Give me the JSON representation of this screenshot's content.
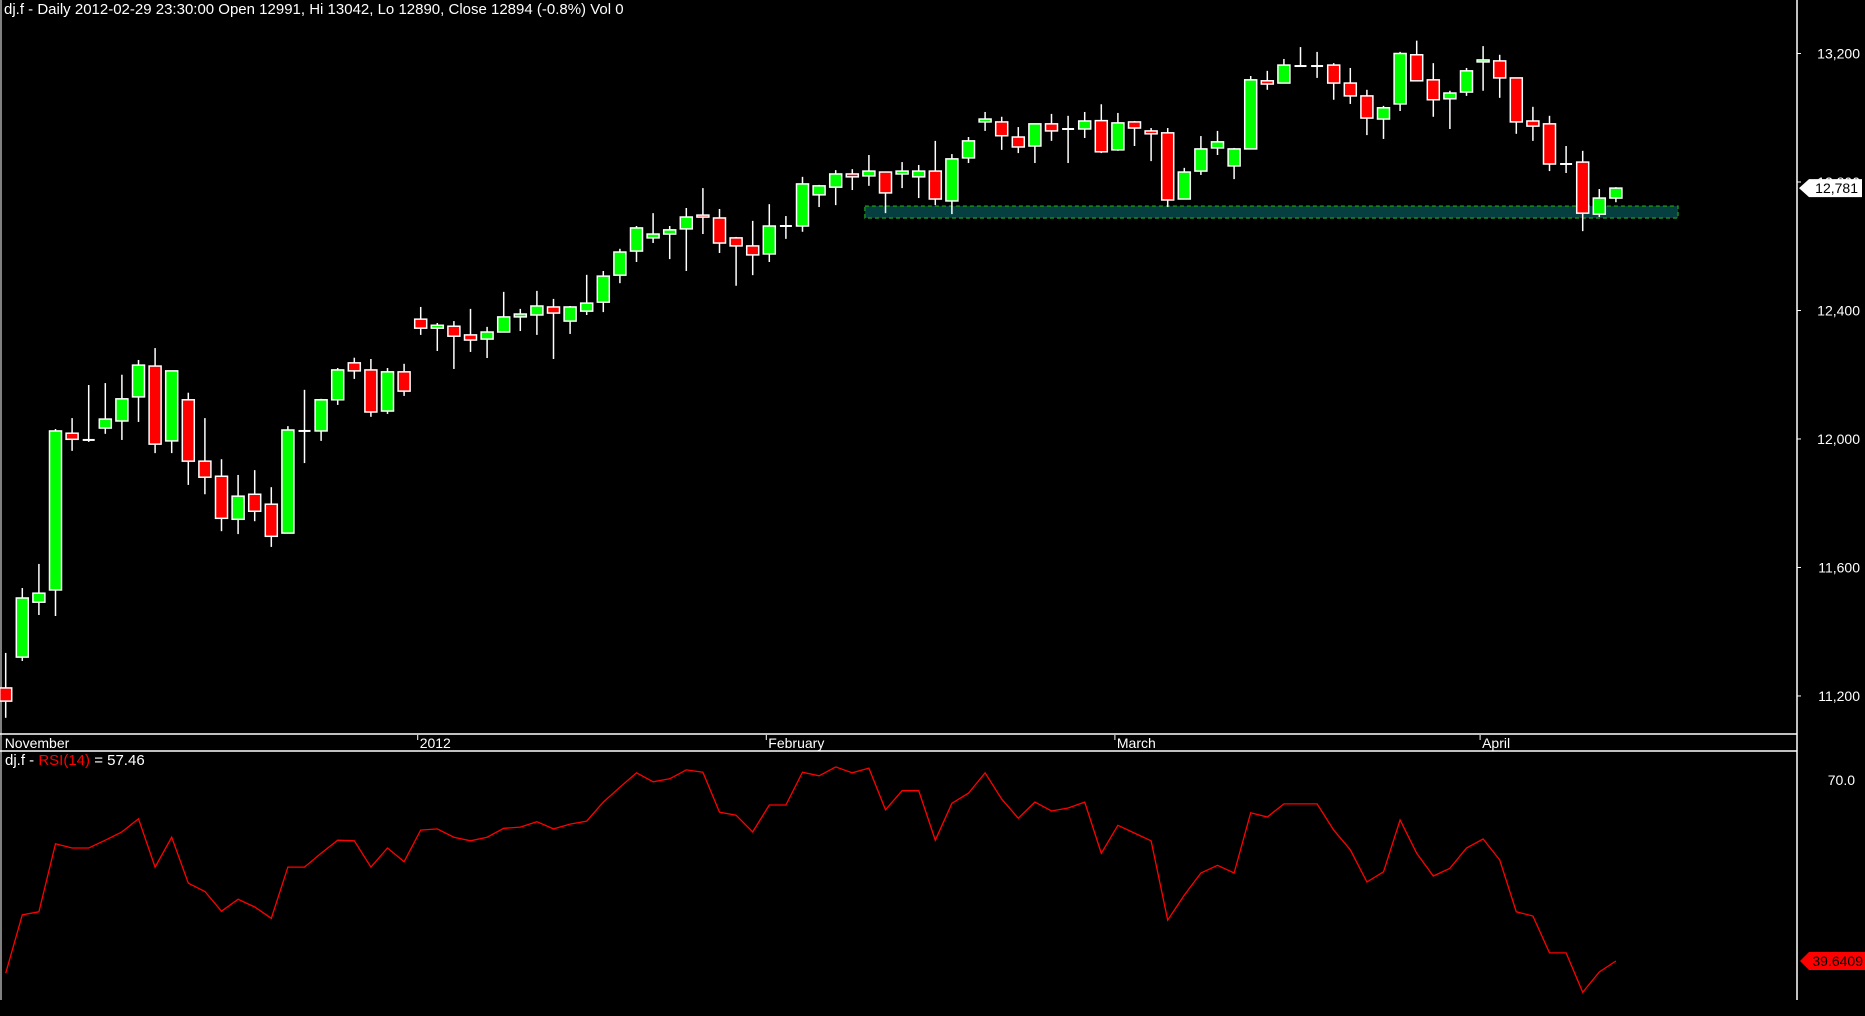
{
  "header": {
    "symbol": "dj.f",
    "text": "dj.f - Daily 2012-02-29 23:30:00 Open 12991, Hi 13042, Lo 12890, Close 12894 (-0.8%) Vol 0"
  },
  "rsi_header": {
    "prefix": "dj.f - ",
    "indicator": "RSI(14)",
    "value_text": " = 57.46"
  },
  "colors": {
    "up": "#00ff00",
    "down": "#ff0000",
    "outline": "#ffffff",
    "rsi": "#ff0000",
    "zone_fill": "#053f3f",
    "zone_border": "#1a8a1a"
  },
  "chart_data": [
    {
      "type": "candlestick",
      "title": "dj.f - Daily",
      "ylim": [
        11200,
        13200
      ],
      "y_ticks": [
        13200,
        12800,
        12400,
        12000,
        11600,
        11200
      ],
      "y_tick_labels": [
        "13,200",
        "12,800",
        "12,400",
        "12,000",
        "11,600",
        "11,200"
      ],
      "x_labels": [
        {
          "label": "November",
          "bar": 0
        },
        {
          "label": "2012",
          "bar": 25
        },
        {
          "label": "February",
          "bar": 46
        },
        {
          "label": "March",
          "bar": 67
        },
        {
          "label": "April",
          "bar": 89
        }
      ],
      "last_price_label": "12,781",
      "last_price": 12781,
      "support_zone": {
        "low": 12688,
        "high": 12725,
        "from_bar": 52
      },
      "ohlc": [
        [
          11225,
          11334,
          11132,
          11184
        ],
        [
          11321,
          11536,
          11309,
          11505
        ],
        [
          11492,
          11611,
          11452,
          11520
        ],
        [
          11530,
          12031,
          11449,
          12025
        ],
        [
          12018,
          12065,
          11963,
          11999
        ],
        [
          11997,
          12168,
          11991,
          11997
        ],
        [
          12034,
          12174,
          12016,
          12062
        ],
        [
          12056,
          12200,
          11997,
          12125
        ],
        [
          12131,
          12246,
          12053,
          12230
        ],
        [
          12227,
          12283,
          11956,
          11984
        ],
        [
          11994,
          12212,
          11956,
          12212
        ],
        [
          12122,
          12144,
          11857,
          11931
        ],
        [
          11931,
          12065,
          11828,
          11881
        ],
        [
          11884,
          11937,
          11713,
          11753
        ],
        [
          11750,
          11888,
          11704,
          11822
        ],
        [
          11828,
          11903,
          11744,
          11775
        ],
        [
          11797,
          11850,
          11664,
          11697
        ],
        [
          11707,
          12040,
          11707,
          12028
        ],
        [
          12025,
          12153,
          11925,
          12025
        ],
        [
          12025,
          12125,
          11994,
          12122
        ],
        [
          12122,
          12221,
          12106,
          12215
        ],
        [
          12237,
          12253,
          12187,
          12212
        ],
        [
          12215,
          12249,
          12069,
          12084
        ],
        [
          12087,
          12221,
          12078,
          12209
        ],
        [
          12209,
          12234,
          12134,
          12149
        ],
        [
          12373,
          12411,
          12324,
          12345
        ],
        [
          12345,
          12361,
          12274,
          12354
        ],
        [
          12351,
          12367,
          12218,
          12320
        ],
        [
          12324,
          12405,
          12271,
          12308
        ],
        [
          12311,
          12349,
          12252,
          12333
        ],
        [
          12333,
          12458,
          12333,
          12380
        ],
        [
          12380,
          12405,
          12336,
          12389
        ],
        [
          12386,
          12461,
          12324,
          12414
        ],
        [
          12411,
          12436,
          12249,
          12392
        ],
        [
          12367,
          12414,
          12327,
          12411
        ],
        [
          12398,
          12511,
          12386,
          12423
        ],
        [
          12426,
          12523,
          12395,
          12507
        ],
        [
          12510,
          12592,
          12485,
          12582
        ],
        [
          12585,
          12663,
          12551,
          12657
        ],
        [
          12626,
          12703,
          12610,
          12638
        ],
        [
          12638,
          12663,
          12560,
          12651
        ],
        [
          12654,
          12719,
          12523,
          12691
        ],
        [
          12697,
          12781,
          12638,
          12691
        ],
        [
          12688,
          12716,
          12579,
          12610
        ],
        [
          12626,
          12629,
          12477,
          12601
        ],
        [
          12601,
          12679,
          12510,
          12573
        ],
        [
          12576,
          12731,
          12551,
          12663
        ],
        [
          12663,
          12694,
          12623,
          12663
        ],
        [
          12663,
          12816,
          12645,
          12794
        ],
        [
          12760,
          12791,
          12722,
          12788
        ],
        [
          12784,
          12837,
          12728,
          12825
        ],
        [
          12825,
          12840,
          12775,
          12816
        ],
        [
          12819,
          12884,
          12788,
          12834
        ],
        [
          12831,
          12831,
          12703,
          12766
        ],
        [
          12825,
          12862,
          12781,
          12834
        ],
        [
          12816,
          12853,
          12750,
          12834
        ],
        [
          12834,
          12928,
          12728,
          12747
        ],
        [
          12741,
          12887,
          12700,
          12872
        ],
        [
          12875,
          12940,
          12859,
          12928
        ],
        [
          12987,
          13018,
          12959,
          12996
        ],
        [
          12987,
          13003,
          12900,
          12944
        ],
        [
          12940,
          12971,
          12890,
          12909
        ],
        [
          12912,
          12981,
          12859,
          12981
        ],
        [
          12981,
          13012,
          12928,
          12959
        ],
        [
          12965,
          13006,
          12859,
          12965
        ],
        [
          12965,
          13018,
          12937,
          12990
        ],
        [
          12991,
          13042,
          12890,
          12894
        ],
        [
          12900,
          13015,
          12897,
          12984
        ],
        [
          12987,
          12990,
          12912,
          12968
        ],
        [
          12959,
          12968,
          12865,
          12950
        ],
        [
          12953,
          12968,
          12722,
          12744
        ],
        [
          12747,
          12844,
          12747,
          12831
        ],
        [
          12834,
          12943,
          12822,
          12903
        ],
        [
          12906,
          12959,
          12884,
          12925
        ],
        [
          12850,
          12906,
          12809,
          12903
        ],
        [
          12903,
          13130,
          12903,
          13118
        ],
        [
          13115,
          13146,
          13087,
          13105
        ],
        [
          13108,
          13183,
          13108,
          13164
        ],
        [
          13161,
          13220,
          13161,
          13161
        ],
        [
          13161,
          13205,
          13124,
          13161
        ],
        [
          13164,
          13170,
          13056,
          13108
        ],
        [
          13108,
          13155,
          13043,
          13068
        ],
        [
          13068,
          13087,
          12946,
          12999
        ],
        [
          12996,
          13037,
          12934,
          13031
        ],
        [
          13043,
          13205,
          13021,
          13200
        ],
        [
          13196,
          13240,
          13115,
          13115
        ],
        [
          13118,
          13170,
          13003,
          13056
        ],
        [
          13059,
          13084,
          12965,
          13077
        ],
        [
          13080,
          13155,
          13068,
          13146
        ],
        [
          13174,
          13223,
          13084,
          13180
        ],
        [
          13177,
          13196,
          13062,
          13124
        ],
        [
          13124,
          13124,
          12950,
          12987
        ],
        [
          12990,
          13034,
          12928,
          12974
        ],
        [
          12981,
          13006,
          12834,
          12856
        ],
        [
          12856,
          12912,
          12828,
          12856
        ],
        [
          12862,
          12897,
          12647,
          12703
        ],
        [
          12700,
          12778,
          12691,
          12750
        ],
        [
          12750,
          12784,
          12737,
          12781
        ]
      ]
    },
    {
      "type": "line",
      "title": "RSI(14)",
      "y_ticks": [
        70
      ],
      "y_tick_labels": [
        "70.0"
      ],
      "last_value_label": "39.6409",
      "values": [
        37.6,
        47.4,
        47.9,
        59.3,
        58.6,
        58.6,
        59.9,
        61.3,
        63.5,
        55.4,
        60.4,
        52.7,
        51.3,
        48.0,
        50.0,
        48.7,
        46.8,
        55.4,
        55.4,
        57.7,
        59.9,
        59.8,
        55.4,
        58.6,
        56.3,
        61.6,
        61.8,
        60.4,
        59.8,
        60.4,
        61.9,
        62.1,
        63.0,
        61.8,
        62.6,
        63.1,
        66.3,
        68.8,
        71.2,
        69.7,
        70.2,
        71.7,
        71.3,
        64.6,
        64.1,
        61.3,
        65.8,
        65.8,
        71.3,
        70.7,
        72.2,
        71.2,
        72.0,
        65.0,
        68.2,
        68.2,
        59.9,
        66.1,
        67.8,
        71.2,
        66.8,
        63.6,
        66.3,
        64.8,
        65.3,
        66.3,
        57.7,
        62.4,
        61.1,
        59.8,
        46.5,
        50.7,
        54.4,
        55.7,
        54.4,
        64.5,
        63.8,
        66.0,
        66.0,
        66.0,
        61.6,
        58.3,
        52.9,
        54.6,
        63.3,
        57.7,
        53.9,
        55.2,
        58.6,
        60.1,
        56.6,
        47.9,
        47.2,
        41.0,
        41.0,
        34.4,
        37.8,
        39.64
      ]
    }
  ]
}
